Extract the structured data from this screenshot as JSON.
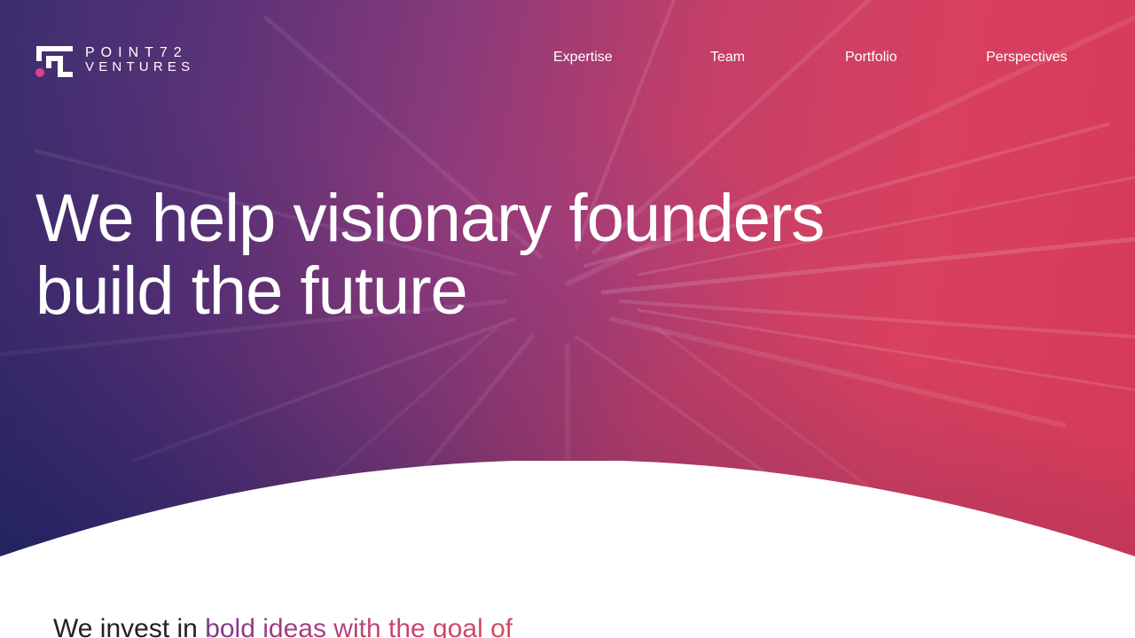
{
  "brand": {
    "name_line1": "POINT72",
    "name_line2": "VENTURES",
    "accent_color": "#e03f8e"
  },
  "nav": {
    "items": [
      {
        "label": "Expertise"
      },
      {
        "label": "Team"
      },
      {
        "label": "Portfolio"
      },
      {
        "label": "Perspectives"
      }
    ]
  },
  "hero": {
    "headline_line1": "We help visionary founders",
    "headline_line2": "build the future",
    "gradient_colors": [
      "#3b2e6e",
      "#8a3a7a",
      "#d8405f"
    ]
  },
  "intro": {
    "text_plain": "We invest in ",
    "text_accent": "bold ideas with the goal of"
  }
}
